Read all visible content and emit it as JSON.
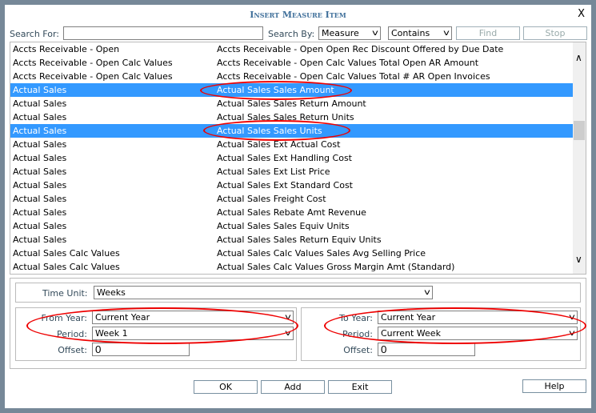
{
  "title": "Insert Measure Item",
  "close_label": "X",
  "search": {
    "label": "Search For:",
    "value": "",
    "search_by_label": "Search By:",
    "search_by_value": "Measure",
    "match_value": "Contains",
    "find_label": "Find",
    "stop_label": "Stop"
  },
  "rows": [
    {
      "group": "Accts Receivable - Open",
      "measure": "Accts Receivable - Open Open Rec Discount Offered by Due Date",
      "selected": false
    },
    {
      "group": "Accts Receivable - Open Calc Values",
      "measure": "Accts Receivable - Open Calc Values Total Open AR Amount",
      "selected": false
    },
    {
      "group": "Accts Receivable - Open Calc Values",
      "measure": "Accts Receivable - Open Calc Values Total # AR Open Invoices",
      "selected": false
    },
    {
      "group": "Actual Sales",
      "measure": "Actual Sales Sales Amount",
      "selected": true
    },
    {
      "group": "Actual Sales",
      "measure": "Actual Sales Sales Return Amount",
      "selected": false
    },
    {
      "group": "Actual Sales",
      "measure": "Actual Sales Sales Return Units",
      "selected": false
    },
    {
      "group": "Actual Sales",
      "measure": "Actual Sales Sales Units",
      "selected": true
    },
    {
      "group": "Actual Sales",
      "measure": "Actual Sales Ext Actual Cost",
      "selected": false
    },
    {
      "group": "Actual Sales",
      "measure": "Actual Sales Ext Handling Cost",
      "selected": false
    },
    {
      "group": "Actual Sales",
      "measure": "Actual Sales Ext List Price",
      "selected": false
    },
    {
      "group": "Actual Sales",
      "measure": "Actual Sales Ext Standard Cost",
      "selected": false
    },
    {
      "group": "Actual Sales",
      "measure": "Actual Sales Freight Cost",
      "selected": false
    },
    {
      "group": "Actual Sales",
      "measure": "Actual Sales Rebate Amt Revenue",
      "selected": false
    },
    {
      "group": "Actual Sales",
      "measure": "Actual Sales Sales Equiv Units",
      "selected": false
    },
    {
      "group": "Actual Sales",
      "measure": "Actual Sales Sales Return Equiv Units",
      "selected": false
    },
    {
      "group": "Actual Sales Calc Values",
      "measure": "Actual Sales Calc Values Sales Avg Selling Price",
      "selected": false
    },
    {
      "group": "Actual Sales Calc Values",
      "measure": "Actual Sales Calc Values Gross Margin Amt (Standard)",
      "selected": false
    }
  ],
  "time_unit": {
    "label": "Time Unit:",
    "value": "Weeks"
  },
  "from": {
    "year_label": "From Year:",
    "year_value": "Current Year",
    "period_label": "Period:",
    "period_value": "Week 1",
    "offset_label": "Offset:",
    "offset_value": "0"
  },
  "to": {
    "year_label": "To Year:",
    "year_value": "Current Year",
    "period_label": "Period:",
    "period_value": "Current Week",
    "offset_label": "Offset:",
    "offset_value": "0"
  },
  "buttons": {
    "ok": "OK",
    "add": "Add",
    "exit": "Exit",
    "help": "Help"
  },
  "colors": {
    "selection": "#3399ff",
    "annotation": "#e00000",
    "title": "#3f6f9a"
  }
}
